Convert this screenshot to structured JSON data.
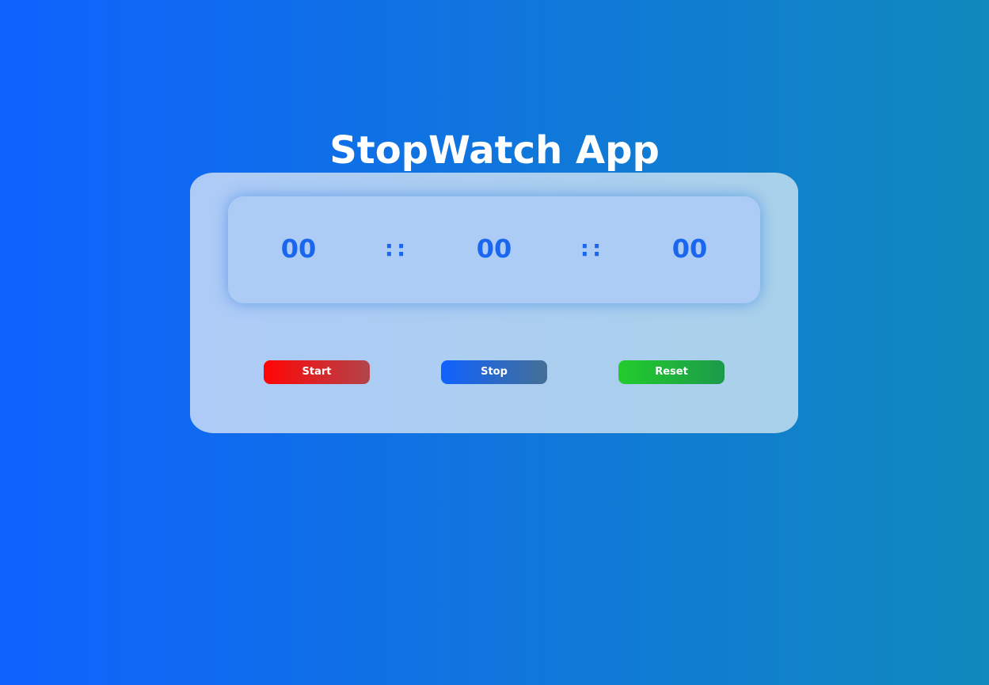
{
  "app": {
    "title": "StopWatch App"
  },
  "display": {
    "hours": "00",
    "separator_1": "::",
    "minutes": "00",
    "separator_2": "::",
    "seconds": "00"
  },
  "controls": {
    "start_label": "Start",
    "stop_label": "Stop",
    "reset_label": "Reset"
  },
  "colors": {
    "background_start": "#0f62fe",
    "background_end": "#1089bd",
    "digits": "#1a66ee",
    "start_button": "#ff0505",
    "stop_button": "#0f62fe",
    "reset_button": "#22cc2c"
  }
}
